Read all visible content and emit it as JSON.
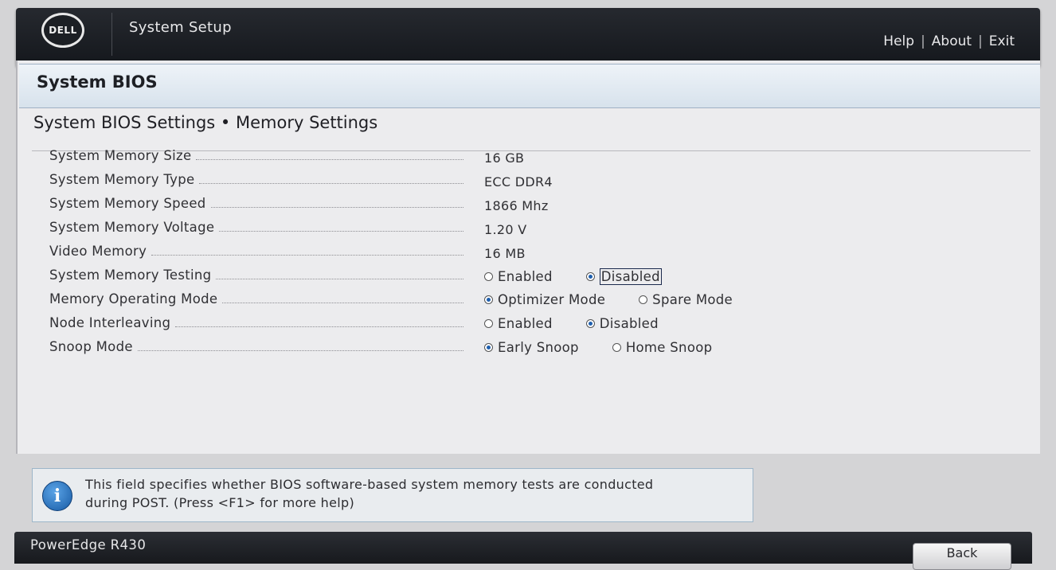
{
  "header": {
    "logo_text": "DELL",
    "title": "System Setup",
    "links": [
      "Help",
      "About",
      "Exit"
    ],
    "separator": "|"
  },
  "section": {
    "title": "System BIOS",
    "breadcrumb": "System BIOS Settings • Memory Settings"
  },
  "settings": [
    {
      "label": "System Memory Size",
      "value": "16 GB"
    },
    {
      "label": "System Memory Type",
      "value": "ECC DDR4"
    },
    {
      "label": "System Memory Speed",
      "value": "1866 Mhz"
    },
    {
      "label": "System Memory Voltage",
      "value": "1.20 V"
    },
    {
      "label": "Video Memory",
      "value": "16 MB"
    },
    {
      "label": "System Memory Testing",
      "options": [
        "Enabled",
        "Disabled"
      ],
      "selected": "Disabled"
    },
    {
      "label": "Memory Operating Mode",
      "options": [
        "Optimizer Mode",
        "Spare Mode"
      ],
      "selected": "Optimizer Mode"
    },
    {
      "label": "Node Interleaving",
      "options": [
        "Enabled",
        "Disabled"
      ],
      "selected": "Disabled"
    },
    {
      "label": "Snoop Mode",
      "options": [
        "Early Snoop",
        "Home Snoop"
      ],
      "selected": "Early Snoop"
    }
  ],
  "help": {
    "icon": "info-icon",
    "icon_glyph": "i",
    "text_line1": "This field specifies whether BIOS software-based system memory tests are conducted",
    "text_line2": "during POST. (Press <F1> for more help)"
  },
  "footer": {
    "model": "PowerEdge R430",
    "back_label": "Back"
  },
  "colors": {
    "header_bg": "#1c1f24",
    "section_header_bg": "#dde6ef",
    "radio_selected": "#1f5fae",
    "info_icon": "#1f6bb8"
  }
}
